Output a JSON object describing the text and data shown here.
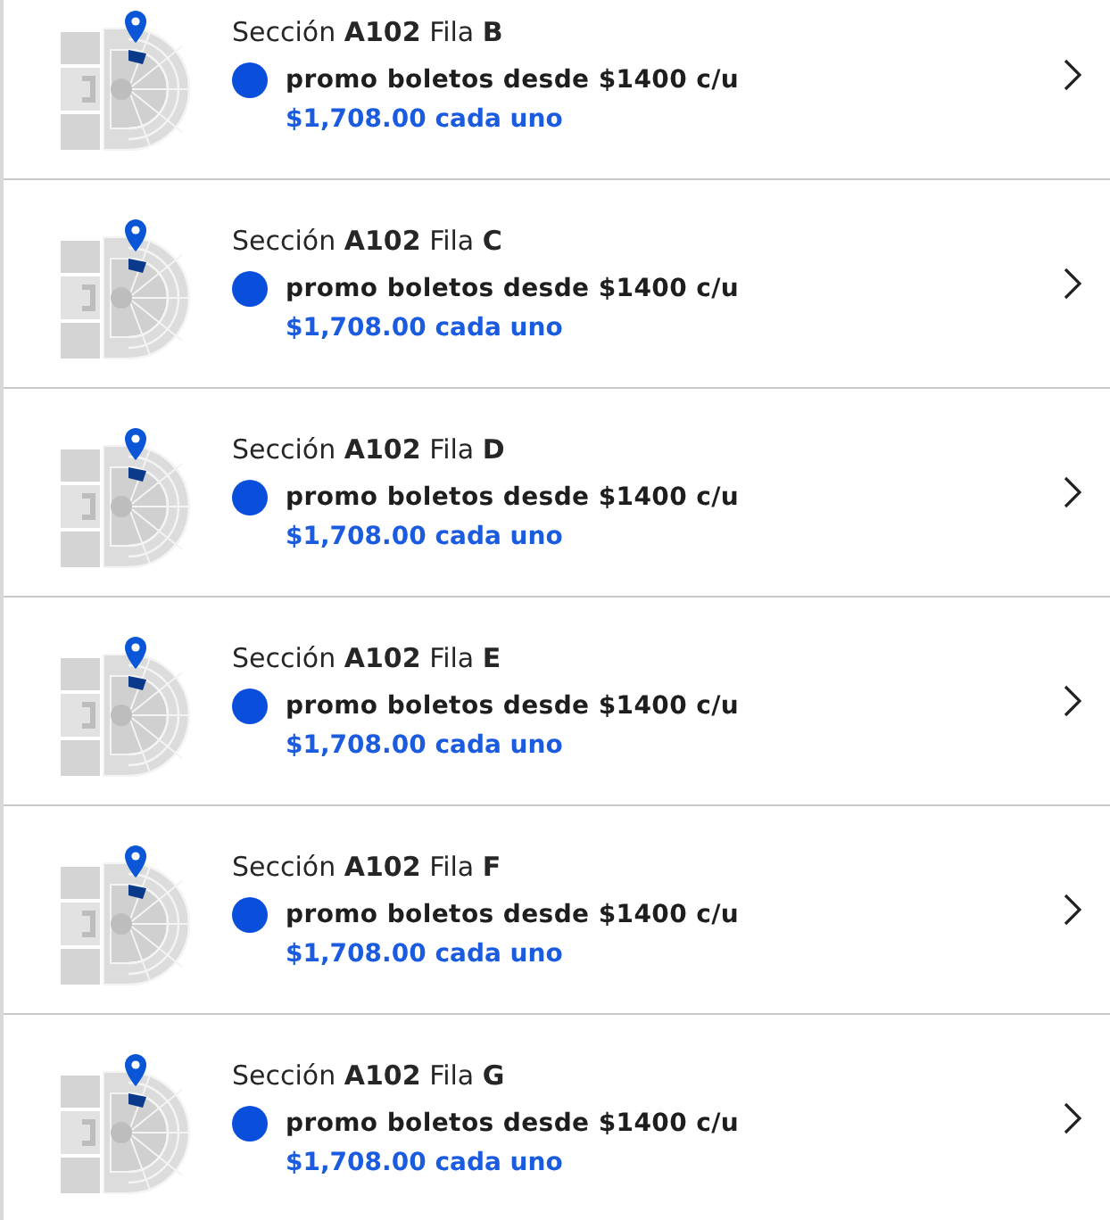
{
  "listings": [
    {
      "title": "Sección **A102**  Fila **B**",
      "promo": "promo boletos desde $1400 c/u",
      "price": "$1,708.00 cada uno"
    },
    {
      "title": "Sección **A102**  Fila **C**",
      "promo": "promo boletos desde $1400 c/u",
      "price": "$1,708.00 cada uno"
    },
    {
      "title": "Sección **A102**  Fila **D**",
      "promo": "promo boletos desde $1400 c/u",
      "price": "$1,708.00 cada uno"
    },
    {
      "title": "Sección **A102**  Fila **E**",
      "promo": "promo boletos desde $1400 c/u",
      "price": "$1,708.00 cada uno"
    },
    {
      "title": "Sección **A102**  Fila **F**",
      "promo": "promo boletos desde $1400 c/u",
      "price": "$1,708.00 cada uno"
    },
    {
      "title": "Sección **A102**  Fila **G**",
      "promo": "promo boletos desde $1400 c/u",
      "price": "$1,708.00 cada uno"
    }
  ]
}
